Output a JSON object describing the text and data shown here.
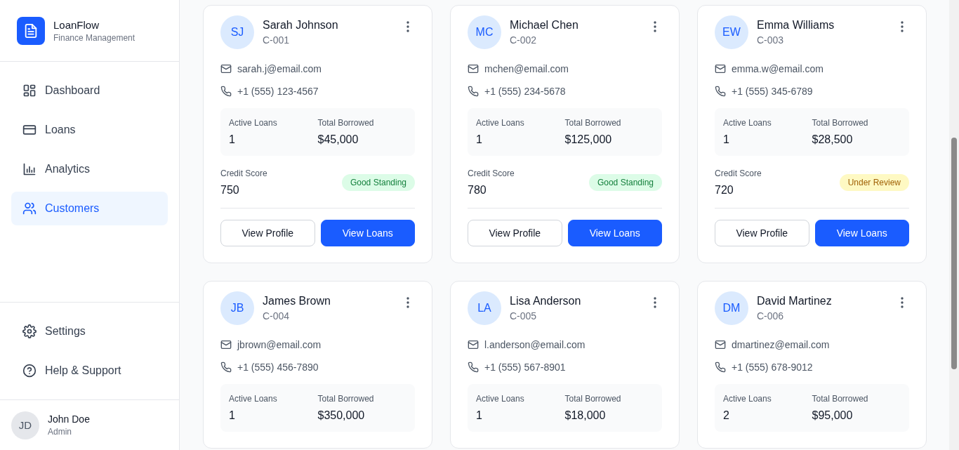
{
  "brand": {
    "name": "LoanFlow",
    "subtitle": "Finance Management"
  },
  "nav": [
    {
      "label": "Dashboard",
      "selected": false
    },
    {
      "label": "Loans",
      "selected": false
    },
    {
      "label": "Analytics",
      "selected": false
    },
    {
      "label": "Customers",
      "selected": true
    }
  ],
  "bottom_nav": [
    {
      "label": "Settings"
    },
    {
      "label": "Help & Support"
    }
  ],
  "user": {
    "initials": "JD",
    "name": "John Doe",
    "role": "Admin"
  },
  "customers": [
    {
      "initials": "SJ",
      "name": "Sarah Johnson",
      "id": "C-001",
      "email": "sarah.j@email.com",
      "phone": "+1 (555) 123-4567",
      "active_loans_label": "Active Loans",
      "active_loans": "1",
      "total_borrowed_label": "Total Borrowed",
      "total_borrowed": "$45,000",
      "credit_score_label": "Credit Score",
      "credit_score": "750",
      "status": {
        "label": "Good Standing",
        "kind": "good"
      },
      "buttons": [
        "View Profile",
        "View Loans"
      ]
    },
    {
      "initials": "MC",
      "name": "Michael Chen",
      "id": "C-002",
      "email": "mchen@email.com",
      "phone": "+1 (555) 234-5678",
      "active_loans_label": "Active Loans",
      "active_loans": "1",
      "total_borrowed_label": "Total Borrowed",
      "total_borrowed": "$125,000",
      "credit_score_label": "Credit Score",
      "credit_score": "780",
      "status": {
        "label": "Good Standing",
        "kind": "good"
      },
      "buttons": [
        "View Profile",
        "View Loans"
      ]
    },
    {
      "initials": "EW",
      "name": "Emma Williams",
      "id": "C-003",
      "email": "emma.w@email.com",
      "phone": "+1 (555) 345-6789",
      "active_loans_label": "Active Loans",
      "active_loans": "1",
      "total_borrowed_label": "Total Borrowed",
      "total_borrowed": "$28,500",
      "credit_score_label": "Credit Score",
      "credit_score": "720",
      "status": {
        "label": "Under Review",
        "kind": "review"
      },
      "buttons": [
        "View Profile",
        "View Loans"
      ]
    },
    {
      "initials": "JB",
      "name": "James Brown",
      "id": "C-004",
      "email": "jbrown@email.com",
      "phone": "+1 (555) 456-7890",
      "active_loans_label": "Active Loans",
      "active_loans": "1",
      "total_borrowed_label": "Total Borrowed",
      "total_borrowed": "$350,000"
    },
    {
      "initials": "LA",
      "name": "Lisa Anderson",
      "id": "C-005",
      "email": "l.anderson@email.com",
      "phone": "+1 (555) 567-8901",
      "active_loans_label": "Active Loans",
      "active_loans": "1",
      "total_borrowed_label": "Total Borrowed",
      "total_borrowed": "$18,000"
    },
    {
      "initials": "DM",
      "name": "David Martinez",
      "id": "C-006",
      "email": "dmartinez@email.com",
      "phone": "+1 (555) 678-9012",
      "active_loans_label": "Active Loans",
      "active_loans": "2",
      "total_borrowed_label": "Total Borrowed",
      "total_borrowed": "$95,000"
    }
  ]
}
